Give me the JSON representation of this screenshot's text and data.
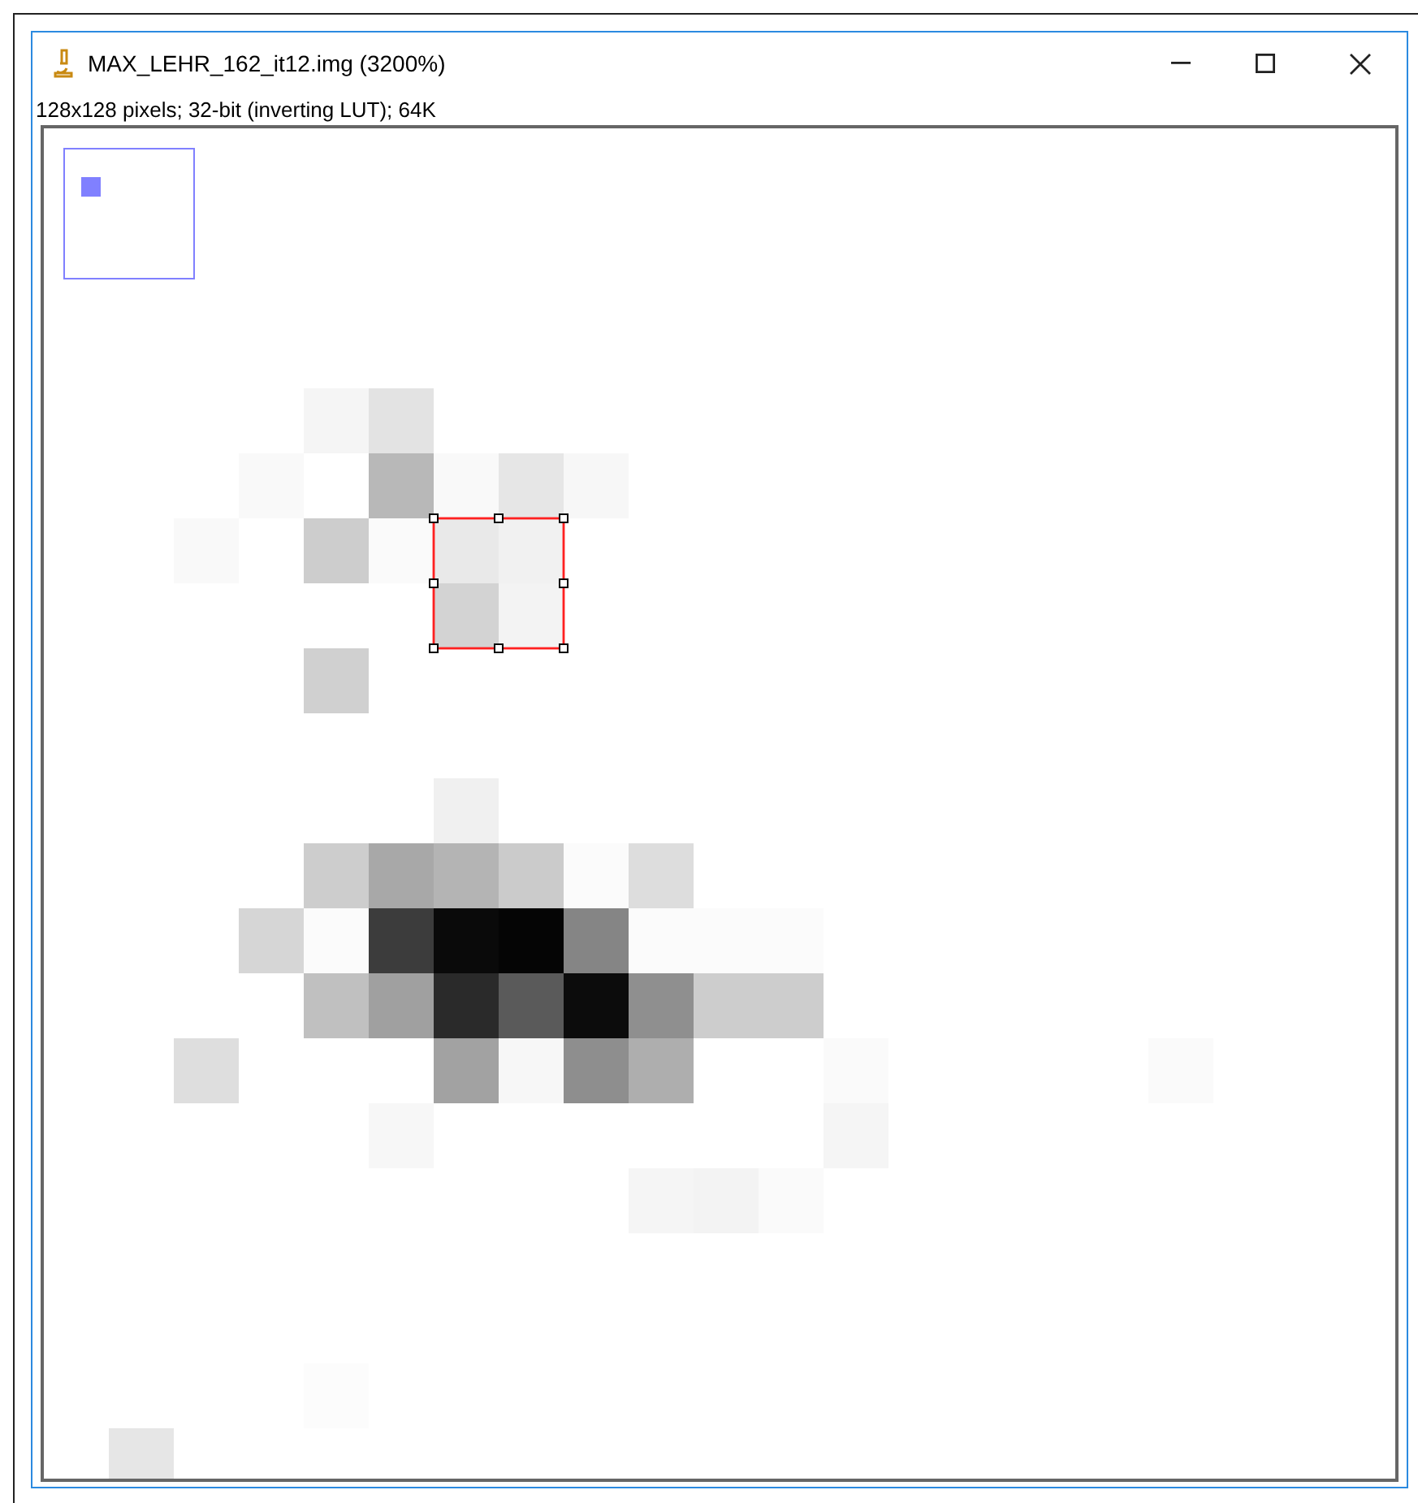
{
  "window": {
    "title": "MAX_LEHR_162_it12.img (3200%)"
  },
  "image_info": "128x128 pixels; 32-bit (inverting LUT); 64K"
}
